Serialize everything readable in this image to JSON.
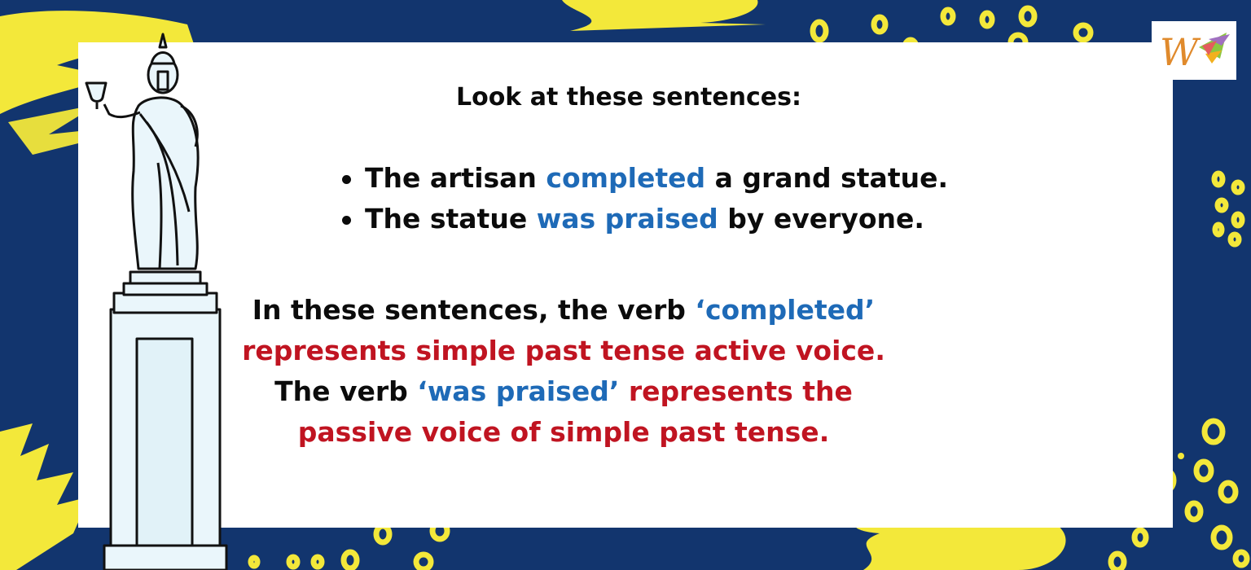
{
  "heading": "Look at these sentences:",
  "examples": [
    {
      "before": "The artisan ",
      "verb": "completed",
      "after": " a grand statue."
    },
    {
      "before": "The statue ",
      "verb": "was praised",
      "after": " by everyone."
    }
  ],
  "explanation": {
    "part1": "In these sentences, the verb ",
    "verb1": "‘completed’",
    "part2": "represents simple past tense active voice.",
    "part3": "The verb ",
    "verb2": "‘was praised’",
    "part4": " represents the passive voice of simple past tense."
  },
  "colors": {
    "background": "#12356e",
    "accent_yellow": "#f3e83a",
    "verb_blue": "#1e6ab7",
    "tense_red": "#c01421"
  },
  "logo": {
    "icon": "w-brand-logo-icon",
    "letter": "W"
  },
  "illustration": {
    "icon": "statue-illustration"
  }
}
